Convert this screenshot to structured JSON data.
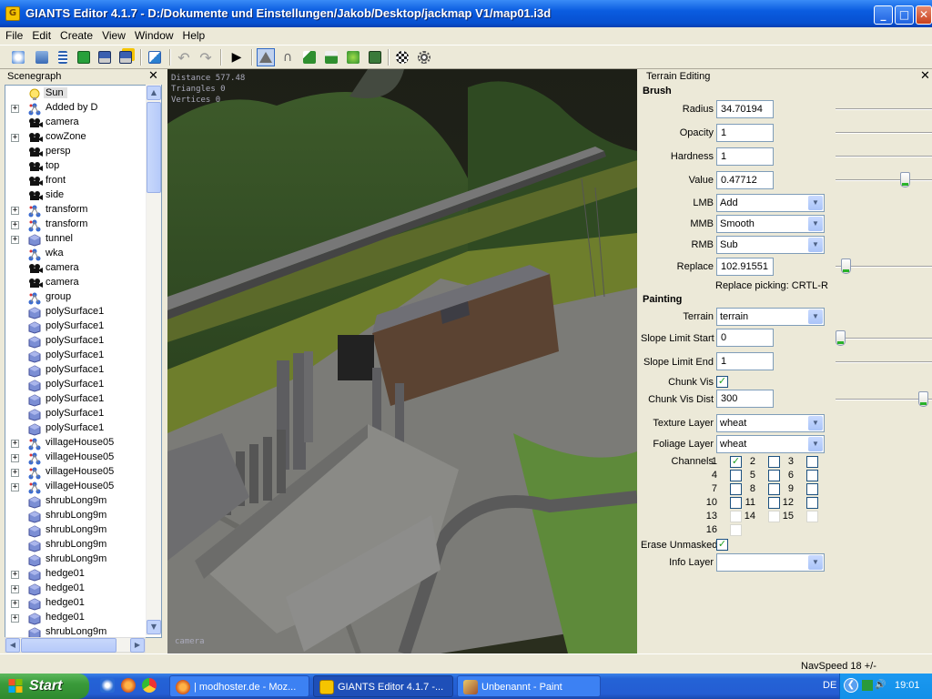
{
  "window": {
    "title": "GIANTS Editor 4.1.7 - D:/Dokumente und Einstellungen/Jakob/Desktop/jackmap V1/map01.i3d",
    "app_icon_letter": "G"
  },
  "menu": [
    "File",
    "Edit",
    "Create",
    "View",
    "Window",
    "Help"
  ],
  "toolbar_icons": [
    "new-icon",
    "open-icon",
    "list-icon",
    "refresh-icon",
    "save-icon",
    "save-as-icon",
    "import-icon",
    "undo-icon",
    "redo-icon",
    "play-icon",
    "home-icon",
    "magnet-icon",
    "terrain-sculpt-icon",
    "terrain-paint-icon",
    "foliage-icon",
    "texture-icon",
    "checker-icon",
    "gear-icon"
  ],
  "scenegraph": {
    "title": "Scenegraph",
    "items": [
      {
        "label": "Sun",
        "icon": "light",
        "expandable": false,
        "selected": true
      },
      {
        "label": "Added by D",
        "icon": "transform",
        "expandable": true
      },
      {
        "label": "camera",
        "icon": "camera",
        "expandable": false
      },
      {
        "label": "cowZone",
        "icon": "camera",
        "expandable": true
      },
      {
        "label": "persp",
        "icon": "camera",
        "expandable": false
      },
      {
        "label": "top",
        "icon": "camera",
        "expandable": false
      },
      {
        "label": "front",
        "icon": "camera",
        "expandable": false
      },
      {
        "label": "side",
        "icon": "camera",
        "expandable": false
      },
      {
        "label": "transform",
        "icon": "transform",
        "expandable": true
      },
      {
        "label": "transform",
        "icon": "transform",
        "expandable": true
      },
      {
        "label": "tunnel",
        "icon": "shape",
        "expandable": true
      },
      {
        "label": "wka",
        "icon": "transform",
        "expandable": false
      },
      {
        "label": "camera",
        "icon": "camera",
        "expandable": false
      },
      {
        "label": "camera",
        "icon": "camera",
        "expandable": false
      },
      {
        "label": "group",
        "icon": "transform",
        "expandable": false
      },
      {
        "label": "polySurface1",
        "icon": "shape",
        "expandable": false
      },
      {
        "label": "polySurface1",
        "icon": "shape",
        "expandable": false
      },
      {
        "label": "polySurface1",
        "icon": "shape",
        "expandable": false
      },
      {
        "label": "polySurface1",
        "icon": "shape",
        "expandable": false
      },
      {
        "label": "polySurface1",
        "icon": "shape",
        "expandable": false
      },
      {
        "label": "polySurface1",
        "icon": "shape",
        "expandable": false
      },
      {
        "label": "polySurface1",
        "icon": "shape",
        "expandable": false
      },
      {
        "label": "polySurface1",
        "icon": "shape",
        "expandable": false
      },
      {
        "label": "polySurface1",
        "icon": "shape",
        "expandable": false
      },
      {
        "label": "villageHouse05",
        "icon": "transform",
        "expandable": true
      },
      {
        "label": "villageHouse05",
        "icon": "transform",
        "expandable": true
      },
      {
        "label": "villageHouse05",
        "icon": "transform",
        "expandable": true
      },
      {
        "label": "villageHouse05",
        "icon": "transform",
        "expandable": true
      },
      {
        "label": "shrubLong9m",
        "icon": "shape",
        "expandable": false
      },
      {
        "label": "shrubLong9m",
        "icon": "shape",
        "expandable": false
      },
      {
        "label": "shrubLong9m",
        "icon": "shape",
        "expandable": false
      },
      {
        "label": "shrubLong9m",
        "icon": "shape",
        "expandable": false
      },
      {
        "label": "shrubLong9m",
        "icon": "shape",
        "expandable": false
      },
      {
        "label": "hedge01",
        "icon": "shape",
        "expandable": true
      },
      {
        "label": "hedge01",
        "icon": "shape",
        "expandable": true
      },
      {
        "label": "hedge01",
        "icon": "shape",
        "expandable": true
      },
      {
        "label": "hedge01",
        "icon": "shape",
        "expandable": true
      },
      {
        "label": "shrubLong9m",
        "icon": "shape",
        "expandable": false
      }
    ]
  },
  "viewport": {
    "stats": [
      "Distance 577.48",
      "Triangles 0",
      "Vertices 0"
    ],
    "camera_label": "camera"
  },
  "terrain": {
    "title": "Terrain Editing",
    "brush_heading": "Brush",
    "radius": {
      "label": "Radius",
      "value": "34.70194"
    },
    "opacity": {
      "label": "Opacity",
      "value": "1"
    },
    "hardness": {
      "label": "Hardness",
      "value": "1"
    },
    "value": {
      "label": "Value",
      "value": "0.47712",
      "slider_fraction": 0.7
    },
    "lmb": {
      "label": "LMB",
      "value": "Add"
    },
    "mmb": {
      "label": "MMB",
      "value": "Smooth"
    },
    "rmb": {
      "label": "RMB",
      "value": "Sub"
    },
    "replace": {
      "label": "Replace",
      "value": "102.91551",
      "slider_fraction": 0.04
    },
    "replace_hint": "Replace picking: CRTL-R",
    "painting_heading": "Painting",
    "terrain_layer": {
      "label": "Terrain",
      "value": "terrain"
    },
    "slope_start": {
      "label": "Slope Limit Start",
      "value": "0",
      "slider_fraction": 0.0
    },
    "slope_end": {
      "label": "Slope Limit End",
      "value": "1"
    },
    "chunk_vis": {
      "label": "Chunk Vis",
      "checked": "✓"
    },
    "chunk_vis_dist": {
      "label": "Chunk Vis Dist",
      "value": "300",
      "slider_fraction": 0.97
    },
    "texture_layer": {
      "label": "Texture Layer",
      "value": "wheat"
    },
    "foliage_layer": {
      "label": "Foliage Layer",
      "value": "wheat"
    },
    "channels_label": "Channels",
    "channels": [
      {
        "n": "1",
        "checked": true
      },
      {
        "n": "2",
        "checked": false
      },
      {
        "n": "3",
        "checked": false
      },
      {
        "n": "4",
        "checked": false
      },
      {
        "n": "5",
        "checked": false
      },
      {
        "n": "6",
        "checked": false
      },
      {
        "n": "7",
        "checked": false
      },
      {
        "n": "8",
        "checked": false
      },
      {
        "n": "9",
        "checked": false
      },
      {
        "n": "10",
        "checked": false
      },
      {
        "n": "11",
        "checked": false
      },
      {
        "n": "12",
        "checked": false
      },
      {
        "n": "13",
        "checked": false,
        "disabled": true
      },
      {
        "n": "14",
        "checked": false,
        "disabled": true
      },
      {
        "n": "15",
        "checked": false,
        "disabled": true
      },
      {
        "n": "16",
        "checked": false,
        "disabled": true
      }
    ],
    "erase_unmasked": {
      "label": "Erase Unmasked",
      "checked": "✓"
    },
    "info_layer": {
      "label": "Info Layer",
      "value": ""
    }
  },
  "status": {
    "navspeed": "NavSpeed 18 +/-"
  },
  "taskbar": {
    "start_label": "Start",
    "tasks": [
      {
        "label": "| modhoster.de - Moz...",
        "icon": "firefox-icon",
        "active": false
      },
      {
        "label": "GIANTS Editor 4.1.7 -...",
        "icon": "giants-icon",
        "active": true
      },
      {
        "label": "Unbenannt - Paint",
        "icon": "paint-icon",
        "active": false
      }
    ],
    "tray_lang": "DE",
    "clock": "19:01"
  },
  "colors": {
    "titlebar": "#0a5ce0",
    "xp_face": "#ece9d8",
    "taskbar": "#245dd3",
    "start_green": "#3a9a3a",
    "check_green": "#21a121"
  }
}
